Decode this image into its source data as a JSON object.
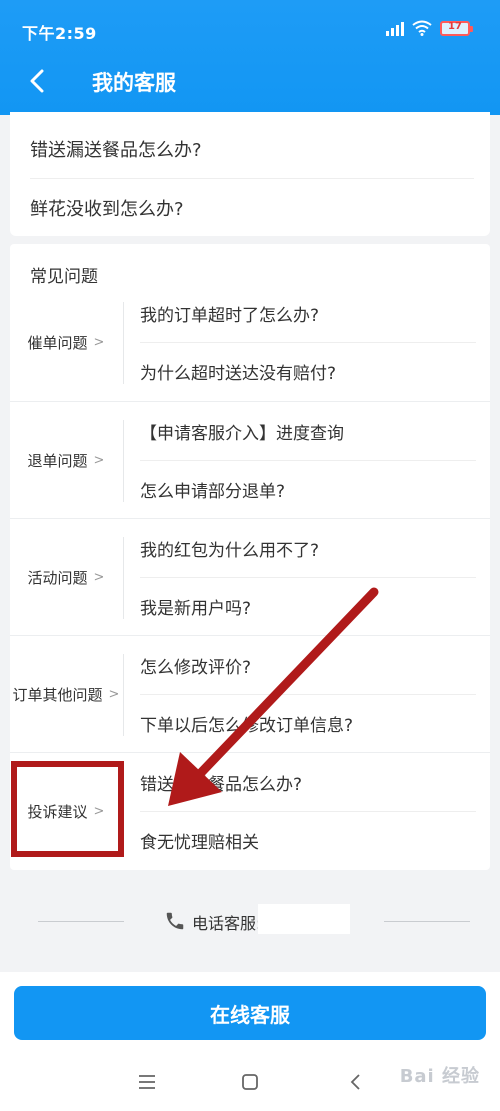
{
  "status_bar": {
    "time": "下午2:59",
    "battery": "17"
  },
  "header": {
    "title": "我的客服",
    "back_icon": "chevron-left-icon"
  },
  "top_faq": [
    "错送漏送餐品怎么办?",
    "鲜花没收到怎么办?"
  ],
  "faq_section": {
    "title": "常见问题",
    "categories": [
      {
        "label": "催单问题",
        "questions": [
          "我的订单超时了怎么办?",
          "为什么超时送达没有赔付?"
        ]
      },
      {
        "label": "退单问题",
        "questions": [
          "【申请客服介入】进度查询",
          "怎么申请部分退单?"
        ]
      },
      {
        "label": "活动问题",
        "questions": [
          "我的红包为什么用不了?",
          "我是新用户吗?"
        ]
      },
      {
        "label": "订单其他问题",
        "questions": [
          "怎么修改评价?",
          "下单以后怎么修改订单信息?"
        ]
      },
      {
        "label": "投诉建议",
        "questions": [
          "错送漏送餐品怎么办?",
          "食无忧理赔相关"
        ]
      }
    ]
  },
  "phone": {
    "label": "电话客服:",
    "icon": "phone-icon"
  },
  "online_button": "在线客服",
  "watermark": "Bai 经验",
  "colors": {
    "brand_blue": "#1296f3",
    "annotation_red": "#b01a1a"
  }
}
